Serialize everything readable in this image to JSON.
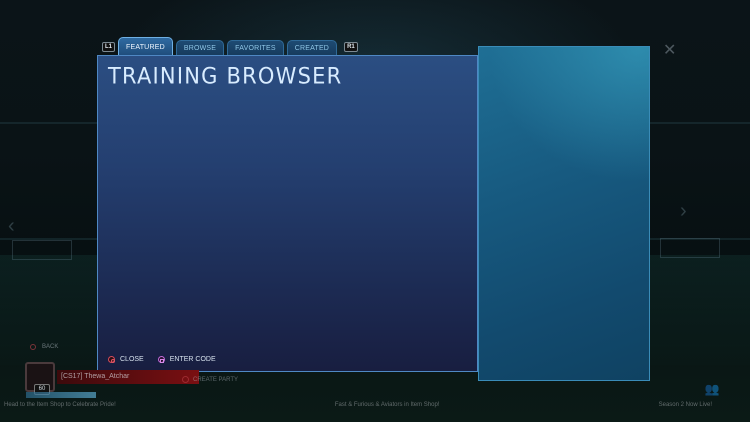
{
  "tabs": {
    "left_shoulder": "L1",
    "right_shoulder": "R1",
    "items": [
      {
        "label": "FEATURED",
        "active": true
      },
      {
        "label": "BROWSE",
        "active": false
      },
      {
        "label": "FAVORITES",
        "active": false
      },
      {
        "label": "CREATED",
        "active": false
      }
    ]
  },
  "panel": {
    "title": "TRAINING BROWSER",
    "buttons": {
      "close_label": "CLOSE",
      "close_icon": "circle-button-icon",
      "enter_code_label": "ENTER CODE",
      "enter_code_icon": "square-button-icon"
    }
  },
  "background": {
    "back_label": "BACK",
    "player_name": "[CS17] Thewa_Atchar",
    "player_level": "60",
    "create_party_label": "CREATE PARTY",
    "ticker": {
      "left": "Head to the Item Shop to Celebrate Pride!",
      "center": "Fast & Furious & Aviators in Item Shop!",
      "right": "Season 2 Now Live!"
    }
  },
  "colors": {
    "panel_border": "#4f88c4",
    "tab_active": "#2f6aa1",
    "side_panel": "#1f6f95",
    "close_button": "#d64b5a",
    "enter_code_button": "#c36ad9"
  }
}
